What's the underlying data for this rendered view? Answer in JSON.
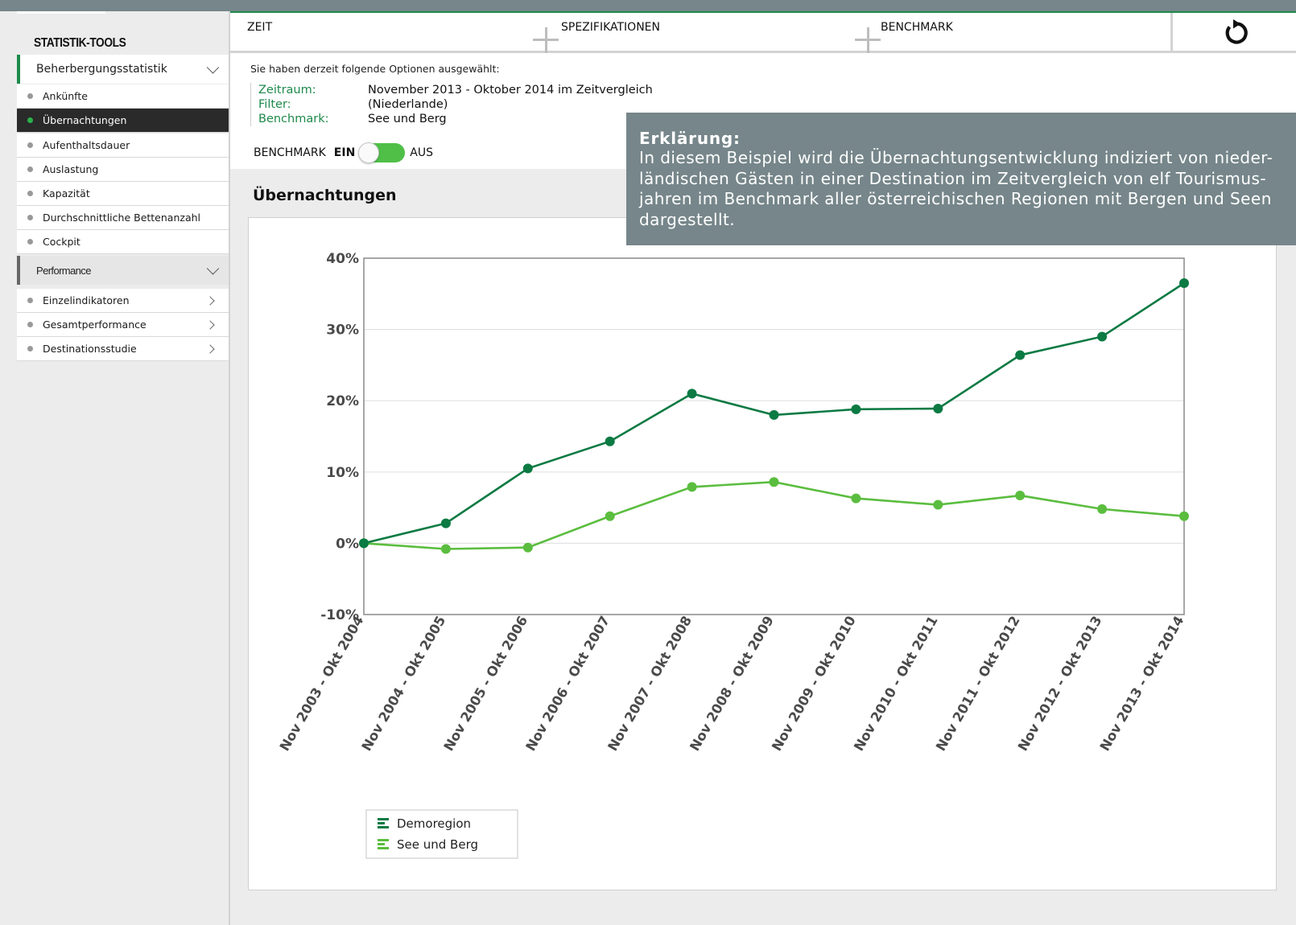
{
  "sidebar": {
    "brand": "STATISTIK-TOOLS",
    "section1": {
      "label": "Beherbergungsstatistik"
    },
    "items": [
      {
        "label": "Ankünfte"
      },
      {
        "label": "Übernachtungen"
      },
      {
        "label": "Aufenthaltsdauer"
      },
      {
        "label": "Auslastung"
      },
      {
        "label": "Kapazität"
      },
      {
        "label": "Durchschnittliche Bettenanzahl"
      },
      {
        "label": "Cockpit"
      }
    ],
    "section2": {
      "label": "Performance"
    },
    "perf_items": [
      {
        "label": "Einzelindikatoren"
      },
      {
        "label": "Gesamtperformance"
      },
      {
        "label": "Destinationsstudie"
      }
    ]
  },
  "tabs": {
    "zeit": "ZEIT",
    "spezifikationen": "SPEZIFIKATIONEN",
    "benchmark": "BENCHMARK",
    "reset_icon": "reset-icon"
  },
  "options": {
    "intro": "Sie haben derzeit folgende Optionen ausgewählt:",
    "rows": [
      {
        "key": "Zeitraum:",
        "value": "November 2013 - Oktober 2014 im Zeitvergleich"
      },
      {
        "key": "Filter:",
        "value": "(Niederlande)"
      },
      {
        "key": "Benchmark:",
        "value": "See und Berg"
      }
    ],
    "benchmark_label": "BENCHMARK",
    "benchmark_on": "EIN",
    "benchmark_off": "AUS",
    "benchmark_enabled": true
  },
  "explanation": {
    "title": "Erklärung:",
    "lines": [
      "In diesem Beispiel wird die Übernachtungsentwicklung indiziert von nieder-",
      "ländischen Gästen in einer Destination im Zeitvergleich von elf Tourismus-",
      "jahren im Benchmark aller österreichischen Regionen mit Bergen und Seen",
      "dargestellt."
    ]
  },
  "chart_title": "Übernachtungen",
  "colors": {
    "accent": "#1d8a4b",
    "demoregion": "#0b7a43",
    "see_und_berg": "#5bbd3f",
    "explain_bg": "#76868a"
  },
  "chart_data": {
    "type": "line",
    "title": "Übernachtungen",
    "categories": [
      "Nov 2003 - Okt 2004",
      "Nov 2004 - Okt 2005",
      "Nov 2005 - Okt 2006",
      "Nov 2006 - Okt 2007",
      "Nov 2007 - Okt 2008",
      "Nov 2008 - Okt 2009",
      "Nov 2009 - Okt 2010",
      "Nov 2010 - Okt 2011",
      "Nov 2011 - Okt 2012",
      "Nov 2012 - Okt 2013",
      "Nov 2013 - Okt 2014"
    ],
    "y_ticks": [
      "40%",
      "30%",
      "20%",
      "10%",
      "0%",
      "-10%"
    ],
    "ylim": [
      -10,
      40
    ],
    "grid": true,
    "legend_position": "bottom-left",
    "series": [
      {
        "name": "Demoregion",
        "values": [
          0,
          2.8,
          10.5,
          14.3,
          21.0,
          18.0,
          18.8,
          18.9,
          26.4,
          29.0,
          36.5
        ]
      },
      {
        "name": "See und Berg",
        "values": [
          0,
          -0.8,
          -0.6,
          3.8,
          7.9,
          8.6,
          6.3,
          5.4,
          6.7,
          4.8,
          3.8
        ]
      }
    ]
  }
}
